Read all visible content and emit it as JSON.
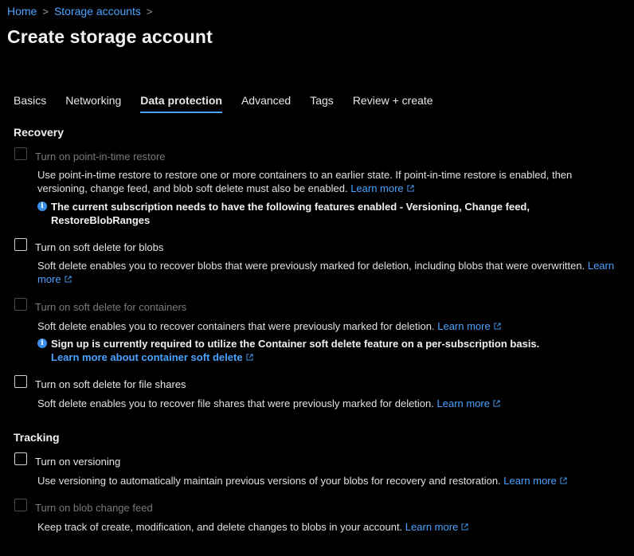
{
  "breadcrumb": {
    "home": "Home",
    "storage": "Storage accounts",
    "separator": ">"
  },
  "title": "Create storage account",
  "tabs": [
    {
      "label": "Basics"
    },
    {
      "label": "Networking"
    },
    {
      "label": "Data protection"
    },
    {
      "label": "Advanced"
    },
    {
      "label": "Tags"
    },
    {
      "label": "Review + create"
    }
  ],
  "recovery": {
    "heading": "Recovery",
    "pitr": {
      "label": "Turn on point-in-time restore",
      "desc": "Use point-in-time restore to restore one or more containers to an earlier state. If point-in-time restore is enabled, then versioning, change feed, and blob soft delete must also be enabled.",
      "learn": "Learn more",
      "info": "The current subscription needs to have the following features enabled - Versioning, Change feed, RestoreBlobRanges"
    },
    "soft_blobs": {
      "label": "Turn on soft delete for blobs",
      "desc": "Soft delete enables you to recover blobs that were previously marked for deletion, including blobs that were overwritten.",
      "learn": "Learn more"
    },
    "soft_containers": {
      "label": "Turn on soft delete for containers",
      "desc": "Soft delete enables you to recover containers that were previously marked for deletion.",
      "learn": "Learn more",
      "info": "Sign up is currently required to utilize the Container soft delete feature on a per-subscription basis.",
      "info_link": "Learn more about container soft delete"
    },
    "soft_files": {
      "label": "Turn on soft delete for file shares",
      "desc": "Soft delete enables you to recover file shares that were previously marked for deletion.",
      "learn": "Learn more"
    }
  },
  "tracking": {
    "heading": "Tracking",
    "versioning": {
      "label": "Turn on versioning",
      "desc": "Use versioning to automatically maintain previous versions of your blobs for recovery and restoration.",
      "learn": "Learn more"
    },
    "changefeed": {
      "label": "Turn on blob change feed",
      "desc": "Keep track of create, modification, and delete changes to blobs in your account.",
      "learn": "Learn more"
    }
  },
  "colors": {
    "accent": "#4aa3ff",
    "info": "#3b8eea",
    "background": "#000000"
  },
  "icons": {
    "external": "external-link-icon",
    "info": "info-icon",
    "chevron": "chevron-right-icon"
  }
}
